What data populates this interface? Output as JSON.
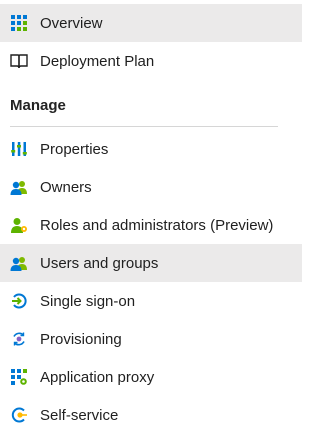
{
  "nav": {
    "top_items": [
      {
        "label": "Overview",
        "icon": "grid-icon",
        "selected": true
      },
      {
        "label": "Deployment Plan",
        "icon": "book-icon",
        "selected": false
      }
    ],
    "manage_section": {
      "title": "Manage",
      "items": [
        {
          "label": "Properties",
          "icon": "properties-icon",
          "selected": false
        },
        {
          "label": "Owners",
          "icon": "users-icon",
          "selected": false
        },
        {
          "label": "Roles and administrators (Preview)",
          "icon": "user-role-icon",
          "selected": false
        },
        {
          "label": "Users and groups",
          "icon": "users-icon",
          "selected": true
        },
        {
          "label": "Single sign-on",
          "icon": "sign-on-icon",
          "selected": false
        },
        {
          "label": "Provisioning",
          "icon": "provisioning-icon",
          "selected": false
        },
        {
          "label": "Application proxy",
          "icon": "app-proxy-icon",
          "selected": false
        },
        {
          "label": "Self-service",
          "icon": "self-service-icon",
          "selected": false
        }
      ]
    }
  },
  "colors": {
    "selected_bg": "#ebeaea",
    "accent_blue": "#0078d4",
    "accent_green": "#5db300"
  }
}
